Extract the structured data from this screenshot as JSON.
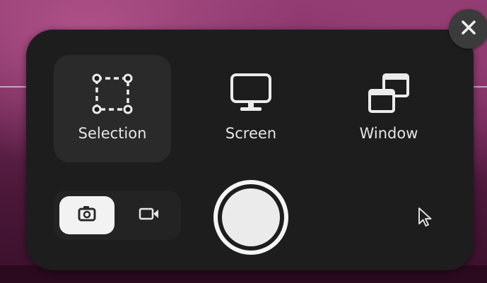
{
  "close": {
    "icon": "close-icon"
  },
  "modes": [
    {
      "label": "Selection",
      "icon": "selection-icon",
      "selected": true
    },
    {
      "label": "Screen",
      "icon": "screen-icon",
      "selected": false
    },
    {
      "label": "Window",
      "icon": "window-icon",
      "selected": false
    }
  ],
  "capture_type": {
    "options": [
      {
        "icon": "screenshot-camera-icon",
        "active": true
      },
      {
        "icon": "screencast-video-icon",
        "active": false
      }
    ]
  },
  "capture_button": {
    "icon": "capture-shutter-icon"
  },
  "show_pointer": {
    "icon": "pointer-icon"
  },
  "colors": {
    "panel": "#1d1d1d",
    "selected_mode": "#2a2a2a",
    "text": "#e6e6e6",
    "accent_light": "#f2f2f2"
  }
}
